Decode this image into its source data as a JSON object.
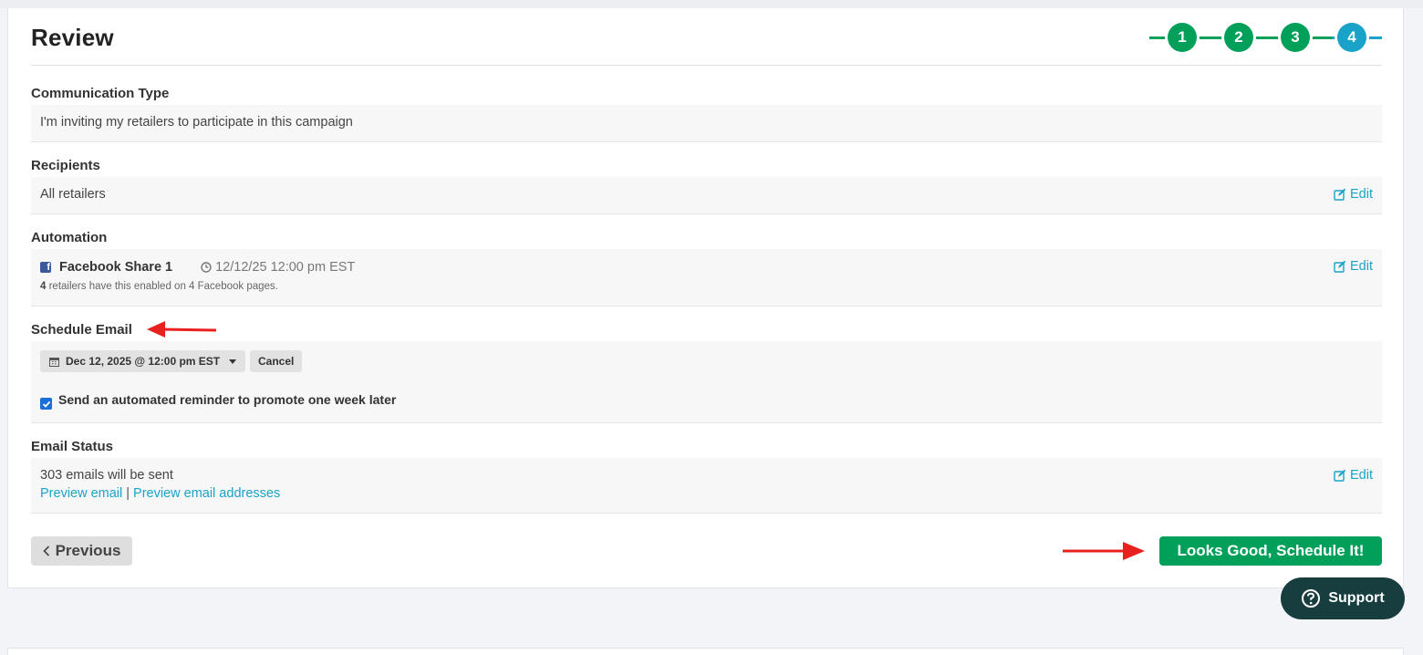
{
  "page": {
    "title": "Review"
  },
  "steps": [
    "1",
    "2",
    "3",
    "4"
  ],
  "sections": {
    "communication_type": {
      "label": "Communication Type",
      "value": "I'm inviting my retailers to participate in this campaign"
    },
    "recipients": {
      "label": "Recipients",
      "value": "All retailers",
      "edit_label": "Edit"
    },
    "automation": {
      "label": "Automation",
      "name": "Facebook Share 1",
      "datetime": "12/12/25 12:00 pm EST",
      "note_count": "4",
      "note_text": " retailers have this enabled on 4 Facebook pages.",
      "edit_label": "Edit"
    },
    "schedule_email": {
      "label": "Schedule Email",
      "date_button": "Dec 12, 2025 @ 12:00 pm EST",
      "cancel_label": "Cancel",
      "reminder_label": "Send an automated reminder to promote one week later",
      "reminder_checked": true
    },
    "email_status": {
      "label": "Email Status",
      "value": "303 emails will be sent",
      "preview_email": "Preview email",
      "separator": "|",
      "preview_addresses": "Preview email addresses",
      "edit_label": "Edit"
    }
  },
  "footer": {
    "previous_label": "Previous",
    "schedule_label": "Looks Good, Schedule It!"
  },
  "support": {
    "label": "Support"
  },
  "colors": {
    "accent_green": "#00a05a",
    "accent_blue": "#1aa3c8",
    "facebook": "#3b5998",
    "annotation_arrow": "#e8211f",
    "support_bg": "#173d3f"
  },
  "icons": {
    "edit": "edit-icon",
    "facebook": "facebook-icon",
    "clock": "clock-icon",
    "calendar": "calendar-icon",
    "chevron_left": "chevron-left-icon",
    "help": "question-circle-icon"
  }
}
